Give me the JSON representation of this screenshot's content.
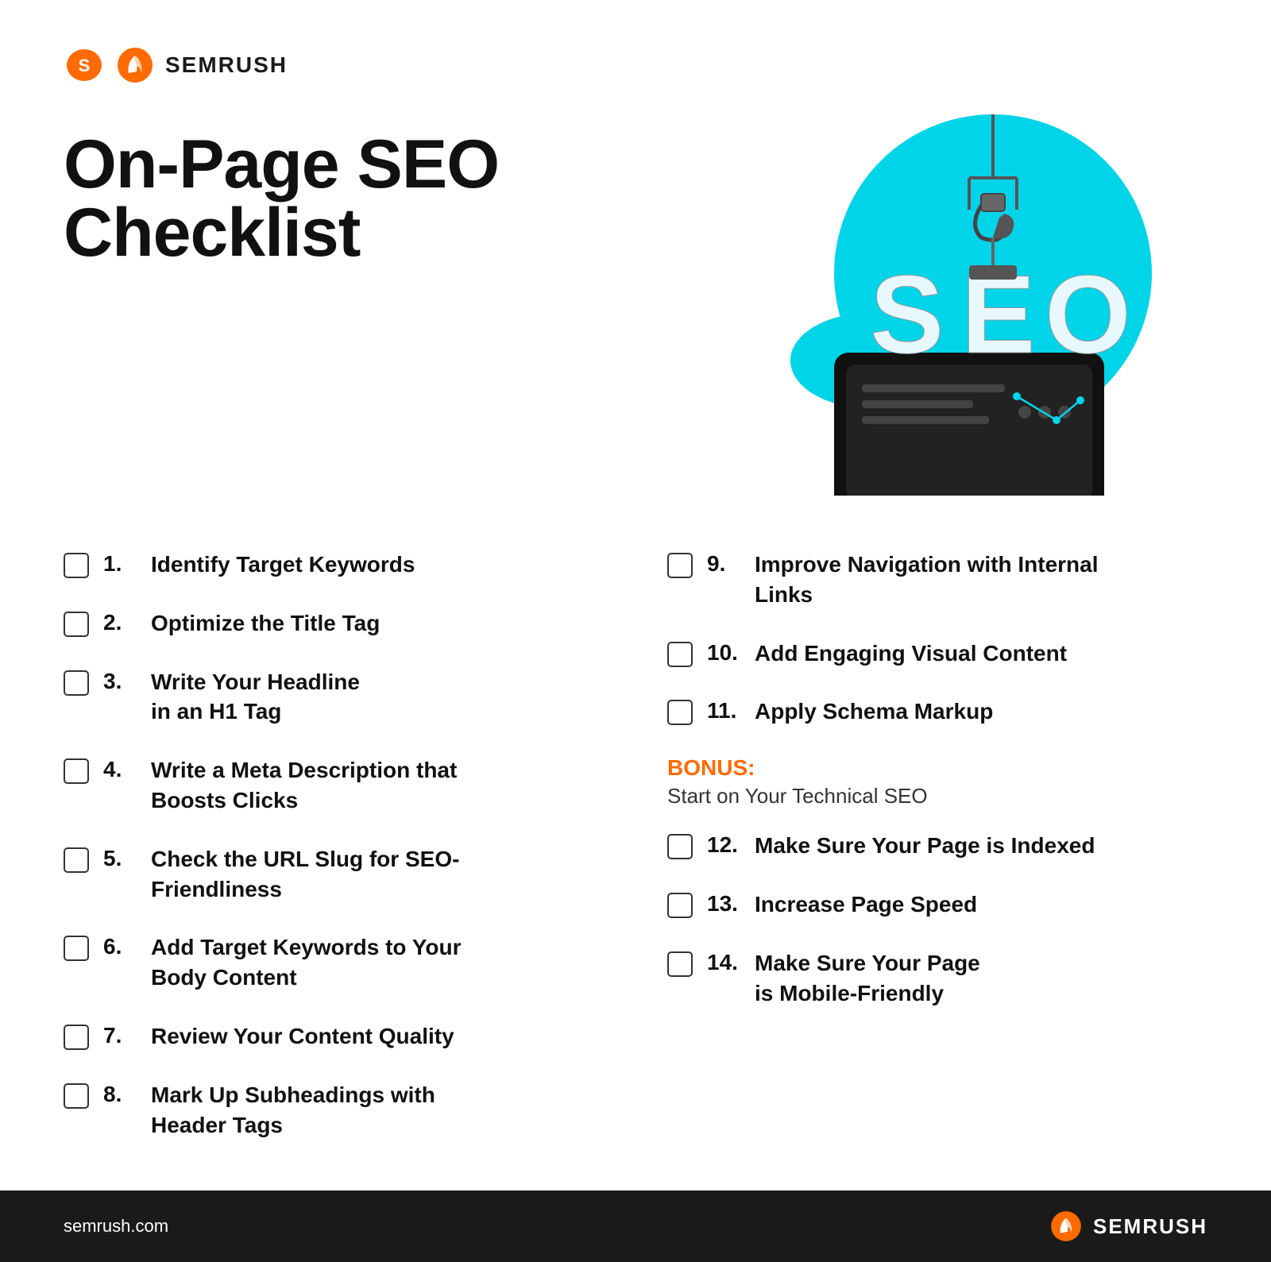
{
  "brand": {
    "name": "SEMRUSH",
    "url": "semrush.com"
  },
  "page": {
    "title_line1": "On-Page SEO",
    "title_line2": "Checklist"
  },
  "checklist_left": [
    {
      "number": "1.",
      "text": "Identify Target Keywords"
    },
    {
      "number": "2.",
      "text": "Optimize the Title Tag"
    },
    {
      "number": "3.",
      "text": "Write Your Headline\nin an H1 Tag"
    },
    {
      "number": "4.",
      "text": "Write a Meta Description that\nBoosts Clicks"
    },
    {
      "number": "5.",
      "text": "Check the URL Slug for SEO-\nFriendliness"
    },
    {
      "number": "6.",
      "text": "Add Target Keywords to Your\nBody Content"
    },
    {
      "number": "7.",
      "text": "Review Your Content Quality"
    },
    {
      "number": "8.",
      "text": "Mark Up Subheadings with\nHeader Tags"
    }
  ],
  "checklist_right": [
    {
      "number": "9.",
      "text": "Improve Navigation with Internal\nLinks"
    },
    {
      "number": "10.",
      "text": "Add Engaging Visual Content"
    },
    {
      "number": "11.",
      "text": "Apply Schema Markup"
    },
    {
      "number": "12.",
      "text": "Make Sure Your Page is Indexed"
    },
    {
      "number": "13.",
      "text": "Increase Page Speed"
    },
    {
      "number": "14.",
      "text": "Make Sure Your Page\nis Mobile-Friendly"
    }
  ],
  "bonus": {
    "label": "BONUS:",
    "subtitle": "Start on Your Technical SEO"
  },
  "colors": {
    "orange": "#ff6b00",
    "dark": "#1a1a1a",
    "cyan": "#00d4e8",
    "white": "#ffffff"
  }
}
